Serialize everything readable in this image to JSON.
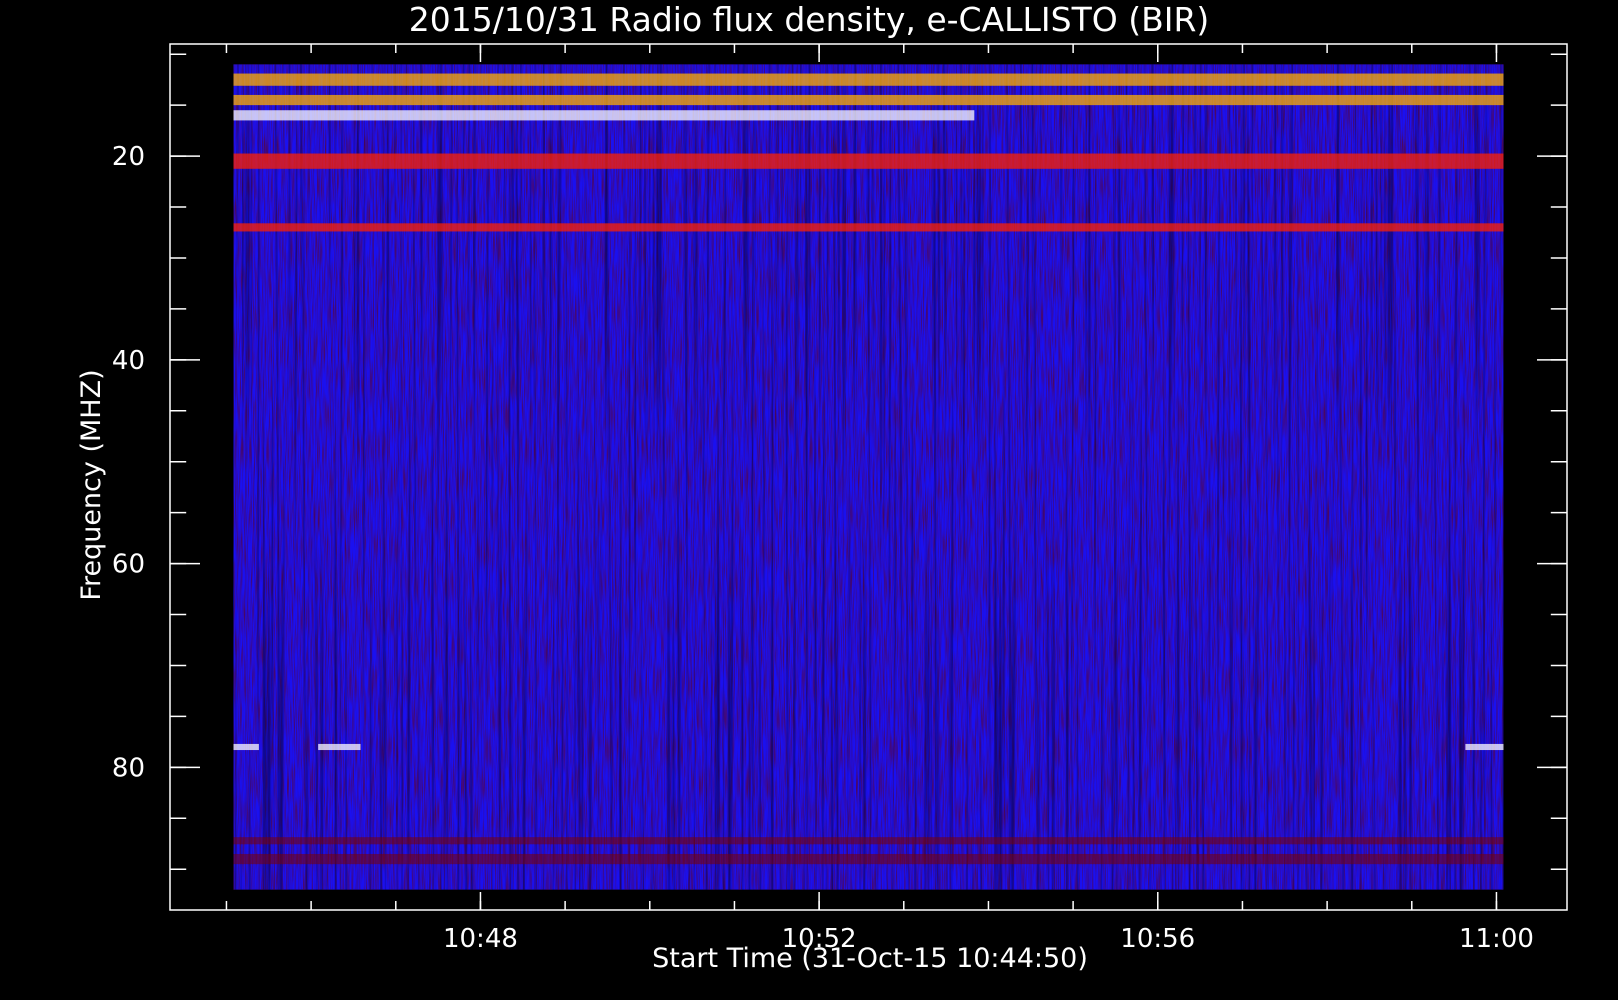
{
  "chart_data": {
    "type": "heatmap",
    "title": "2015/10/31  Radio flux density, e-CALLISTO (BIR)",
    "xlabel": "Start Time (31-Oct-15 10:44:50)",
    "ylabel": "Frequency (MHZ)",
    "x_range_minutes": [
      -0.5,
      16.0
    ],
    "y_range_mhz": [
      9,
      94
    ],
    "data_x_range_minutes": [
      0.25,
      15.25
    ],
    "data_y_range_mhz": [
      11,
      92
    ],
    "x_ticks": [
      {
        "label": "10:48",
        "value": 3.1667
      },
      {
        "label": "10:52",
        "value": 7.1667
      },
      {
        "label": "10:56",
        "value": 11.1667
      },
      {
        "label": "11:00",
        "value": 15.1667
      }
    ],
    "x_minor_step": 1,
    "y_ticks": [
      {
        "label": "20",
        "value": 20
      },
      {
        "label": "40",
        "value": 40
      },
      {
        "label": "60",
        "value": 60
      },
      {
        "label": "80",
        "value": 80
      }
    ],
    "y_minor_step": 5,
    "y_inverted": true,
    "colormap": [
      "#000000",
      "#1400ff",
      "#7a0000",
      "#ff2000",
      "#ffb000",
      "#ffffff"
    ],
    "background_color": "#1a10f0",
    "interference_bands_mhz": [
      {
        "freq": 12.5,
        "width": 1.2,
        "x_from": 0.25,
        "x_to": 15.25,
        "level": "high"
      },
      {
        "freq": 14.5,
        "width": 1.0,
        "x_from": 0.25,
        "x_to": 15.25,
        "level": "high"
      },
      {
        "freq": 16.0,
        "width": 1.0,
        "x_from": 0.25,
        "x_to": 9.0,
        "level": "very-high"
      },
      {
        "freq": 20.5,
        "width": 1.5,
        "x_from": 0.25,
        "x_to": 15.25,
        "level": "medium"
      },
      {
        "freq": 27.0,
        "width": 0.8,
        "x_from": 0.25,
        "x_to": 15.25,
        "level": "medium"
      },
      {
        "freq": 78.0,
        "width": 0.6,
        "x_from": 0.25,
        "x_to": 0.55,
        "level": "very-high"
      },
      {
        "freq": 78.0,
        "width": 0.6,
        "x_from": 1.25,
        "x_to": 1.75,
        "level": "very-high"
      },
      {
        "freq": 78.0,
        "width": 0.6,
        "x_from": 14.8,
        "x_to": 15.25,
        "level": "very-high"
      },
      {
        "freq": 87.2,
        "width": 0.7,
        "x_from": 0.25,
        "x_to": 15.25,
        "level": "low"
      },
      {
        "freq": 89.0,
        "width": 1.0,
        "x_from": 0.25,
        "x_to": 15.25,
        "level": "low"
      }
    ]
  }
}
